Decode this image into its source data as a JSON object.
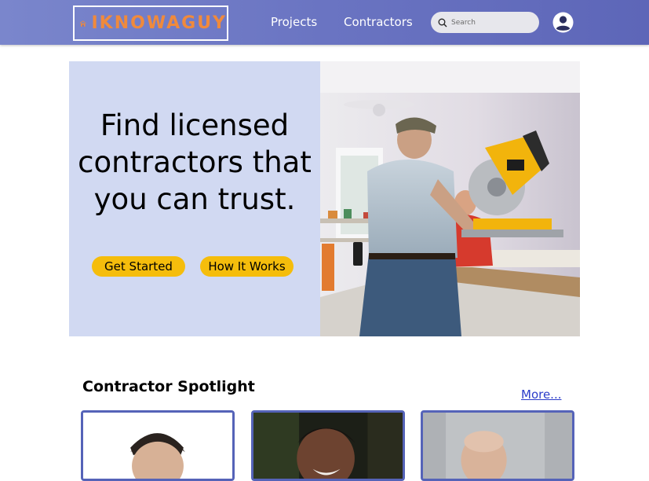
{
  "header": {
    "logo_text": "IKNOWAGUY",
    "nav": [
      {
        "label": "Projects"
      },
      {
        "label": "Contractors"
      }
    ],
    "search": {
      "placeholder": "Search",
      "value": ""
    },
    "colors": {
      "bar": "#6a74c2",
      "logo": "#f08a3c"
    }
  },
  "hero": {
    "title_lines": [
      "Find licensed",
      "contractors that",
      "you can trust."
    ],
    "buttons": [
      {
        "label": "Get Started"
      },
      {
        "label": "How It Works"
      }
    ],
    "photo": "contractors-cutting-wood-photo",
    "colors": {
      "panel": "#d1d9f2",
      "button": "#f5bd0c"
    }
  },
  "spotlight": {
    "title": "Contractor Spotlight",
    "more_label": "More...",
    "cards": [
      {
        "photo": "contractor-portrait-1"
      },
      {
        "photo": "contractor-portrait-2"
      },
      {
        "photo": "contractor-portrait-3"
      }
    ]
  }
}
